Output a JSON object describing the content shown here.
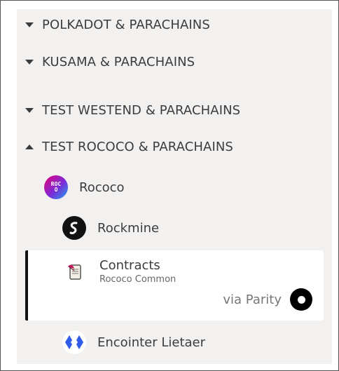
{
  "groups": [
    {
      "label": "POLKADOT & PARACHAINS",
      "state": "collapsed"
    },
    {
      "label": "KUSAMA & PARACHAINS",
      "state": "collapsed"
    },
    {
      "label": "TEST WESTEND & PARACHAINS",
      "state": "collapsed"
    },
    {
      "label": "TEST ROCOCO & PARACHAINS",
      "state": "expanded"
    }
  ],
  "networks": {
    "rococo": {
      "name": "Rococo",
      "logo_text": "ROCO",
      "icon": "rococo-logo-icon"
    },
    "rockmine": {
      "name": "Rockmine",
      "icon": "rockmine-logo-icon"
    },
    "contracts": {
      "name": "Contracts",
      "subtitle": "Rococo Common",
      "provider": "via Parity",
      "icon": "contracts-scroll-icon",
      "provider_icon": "parity-logo-icon",
      "selected": true
    },
    "encointer": {
      "name": "Encointer Lietaer",
      "icon": "encointer-logo-icon"
    }
  },
  "colors": {
    "panel_bg": "#f2f1f0",
    "selected_bar": "#111111",
    "text": "#3c3c3c",
    "encointer_blue": "#2f5be8"
  }
}
